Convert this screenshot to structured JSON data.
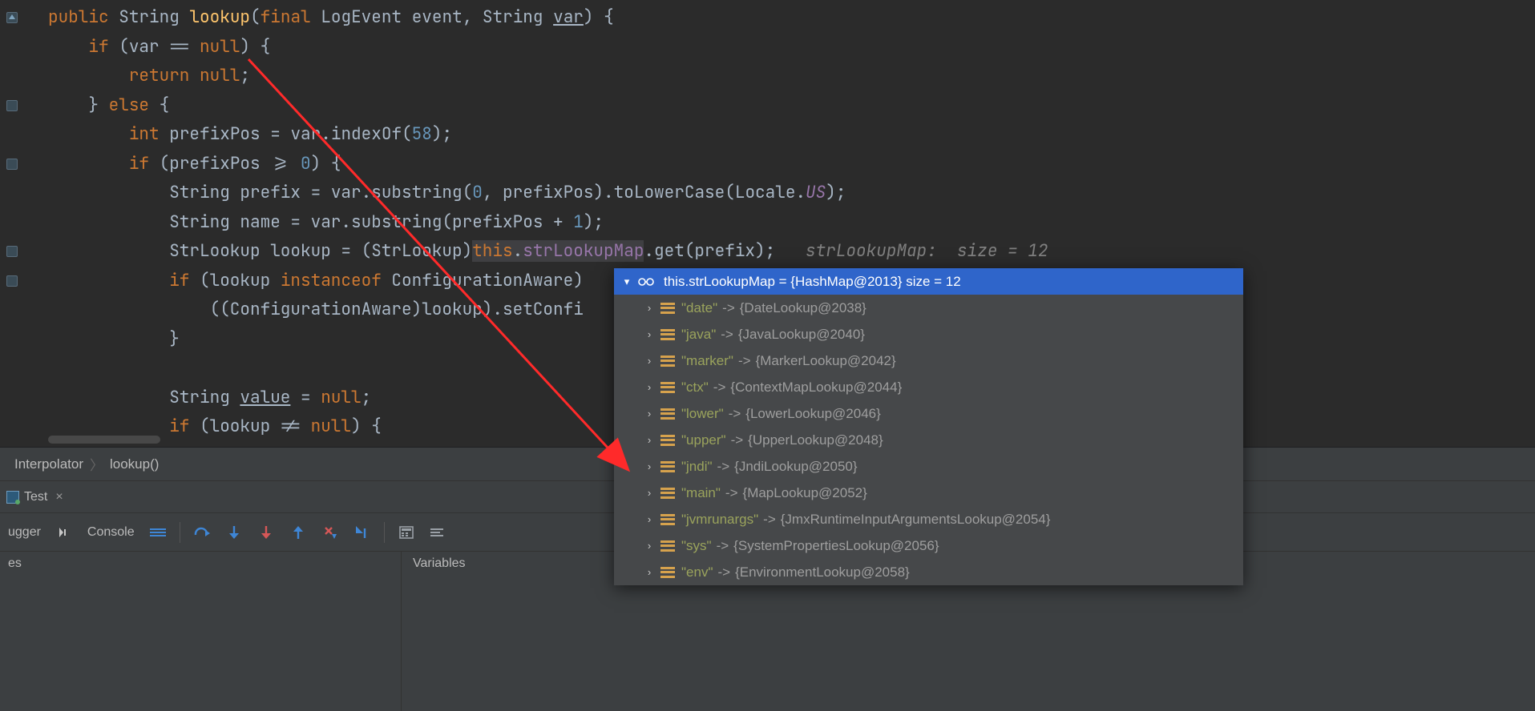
{
  "code": {
    "l1": {
      "kw_public": "public",
      "type_string": "String",
      "method": "lookup",
      "kw_final": "final",
      "type_logevent": "LogEvent",
      "p_event": "event",
      "p_string2": "String",
      "p_var": "var",
      "close": ") {"
    },
    "l2": {
      "kw_if": "if",
      "expr_open": " (",
      "var": "var",
      "op": " == ",
      "null": "null",
      "close": ") {"
    },
    "l3": {
      "kw_return": "return",
      "sp": " ",
      "null": "null",
      "semi": ";"
    },
    "l4": {
      "rbrace": "}",
      "kw_else": " else ",
      "lbrace": "{"
    },
    "l5": {
      "kw_int": "int",
      "decl": " prefixPos = ",
      "var": "var",
      "call": ".indexOf(",
      "num": "58",
      "close": ");"
    },
    "l6": {
      "kw_if": "if",
      "expr": " (prefixPos >= ",
      "num": "0",
      "close": ") {"
    },
    "l7": {
      "t": "String prefix = ",
      "var": "var",
      "call1": ".substring(",
      "num0": "0",
      "mid": ", prefixPos).toLowerCase(Locale.",
      "us": "US",
      "close": ");"
    },
    "l8": {
      "t": "String name = ",
      "var": "var",
      "call": ".substring(prefixPos + ",
      "num1": "1",
      "close": ");"
    },
    "l9": {
      "t1": "StrLookup lookup = (StrLookup)",
      "this": "this",
      "dot": ".",
      "field": "strLookupMap",
      "call": ".get(prefix);",
      "hint_label": "strLookupMap:",
      "hint_val": "  size = 12"
    },
    "l10": {
      "kw_if": "if",
      "open": " (lookup ",
      "kw_instanceof": "instanceof",
      "rest": " ConfigurationAware)"
    },
    "l11": {
      "t": "((ConfigurationAware)lookup).setConfi"
    },
    "l12": {
      "rbrace": "}"
    },
    "l13": {
      "": ""
    },
    "l14": {
      "t": "String ",
      "value": "value",
      "rest": " = ",
      "null": "null",
      "semi": ";"
    },
    "l15": {
      "kw_if": "if",
      "open": " (lookup != ",
      "null": "null",
      "close": ") {"
    }
  },
  "frames": {
    "crumb1": "Interpolator",
    "crumb2": "lookup()"
  },
  "tab": {
    "name": "Test"
  },
  "toolbar": {
    "debugger": "ugger",
    "console": "Console"
  },
  "bottom": {
    "col1": "es",
    "col2": "Variables"
  },
  "popup": {
    "header": "this.strLookupMap = {HashMap@2013}  size = 12",
    "entries": [
      {
        "key": "\"date\"",
        "val": "{DateLookup@2038}"
      },
      {
        "key": "\"java\"",
        "val": "{JavaLookup@2040}"
      },
      {
        "key": "\"marker\"",
        "val": "{MarkerLookup@2042}"
      },
      {
        "key": "\"ctx\"",
        "val": "{ContextMapLookup@2044}"
      },
      {
        "key": "\"lower\"",
        "val": "{LowerLookup@2046}"
      },
      {
        "key": "\"upper\"",
        "val": "{UpperLookup@2048}"
      },
      {
        "key": "\"jndi\"",
        "val": "{JndiLookup@2050}"
      },
      {
        "key": "\"main\"",
        "val": "{MapLookup@2052}"
      },
      {
        "key": "\"jvmrunargs\"",
        "val": "{JmxRuntimeInputArgumentsLookup@2054}"
      },
      {
        "key": "\"sys\"",
        "val": "{SystemPropertiesLookup@2056}"
      },
      {
        "key": "\"env\"",
        "val": "{EnvironmentLookup@2058}"
      }
    ]
  }
}
